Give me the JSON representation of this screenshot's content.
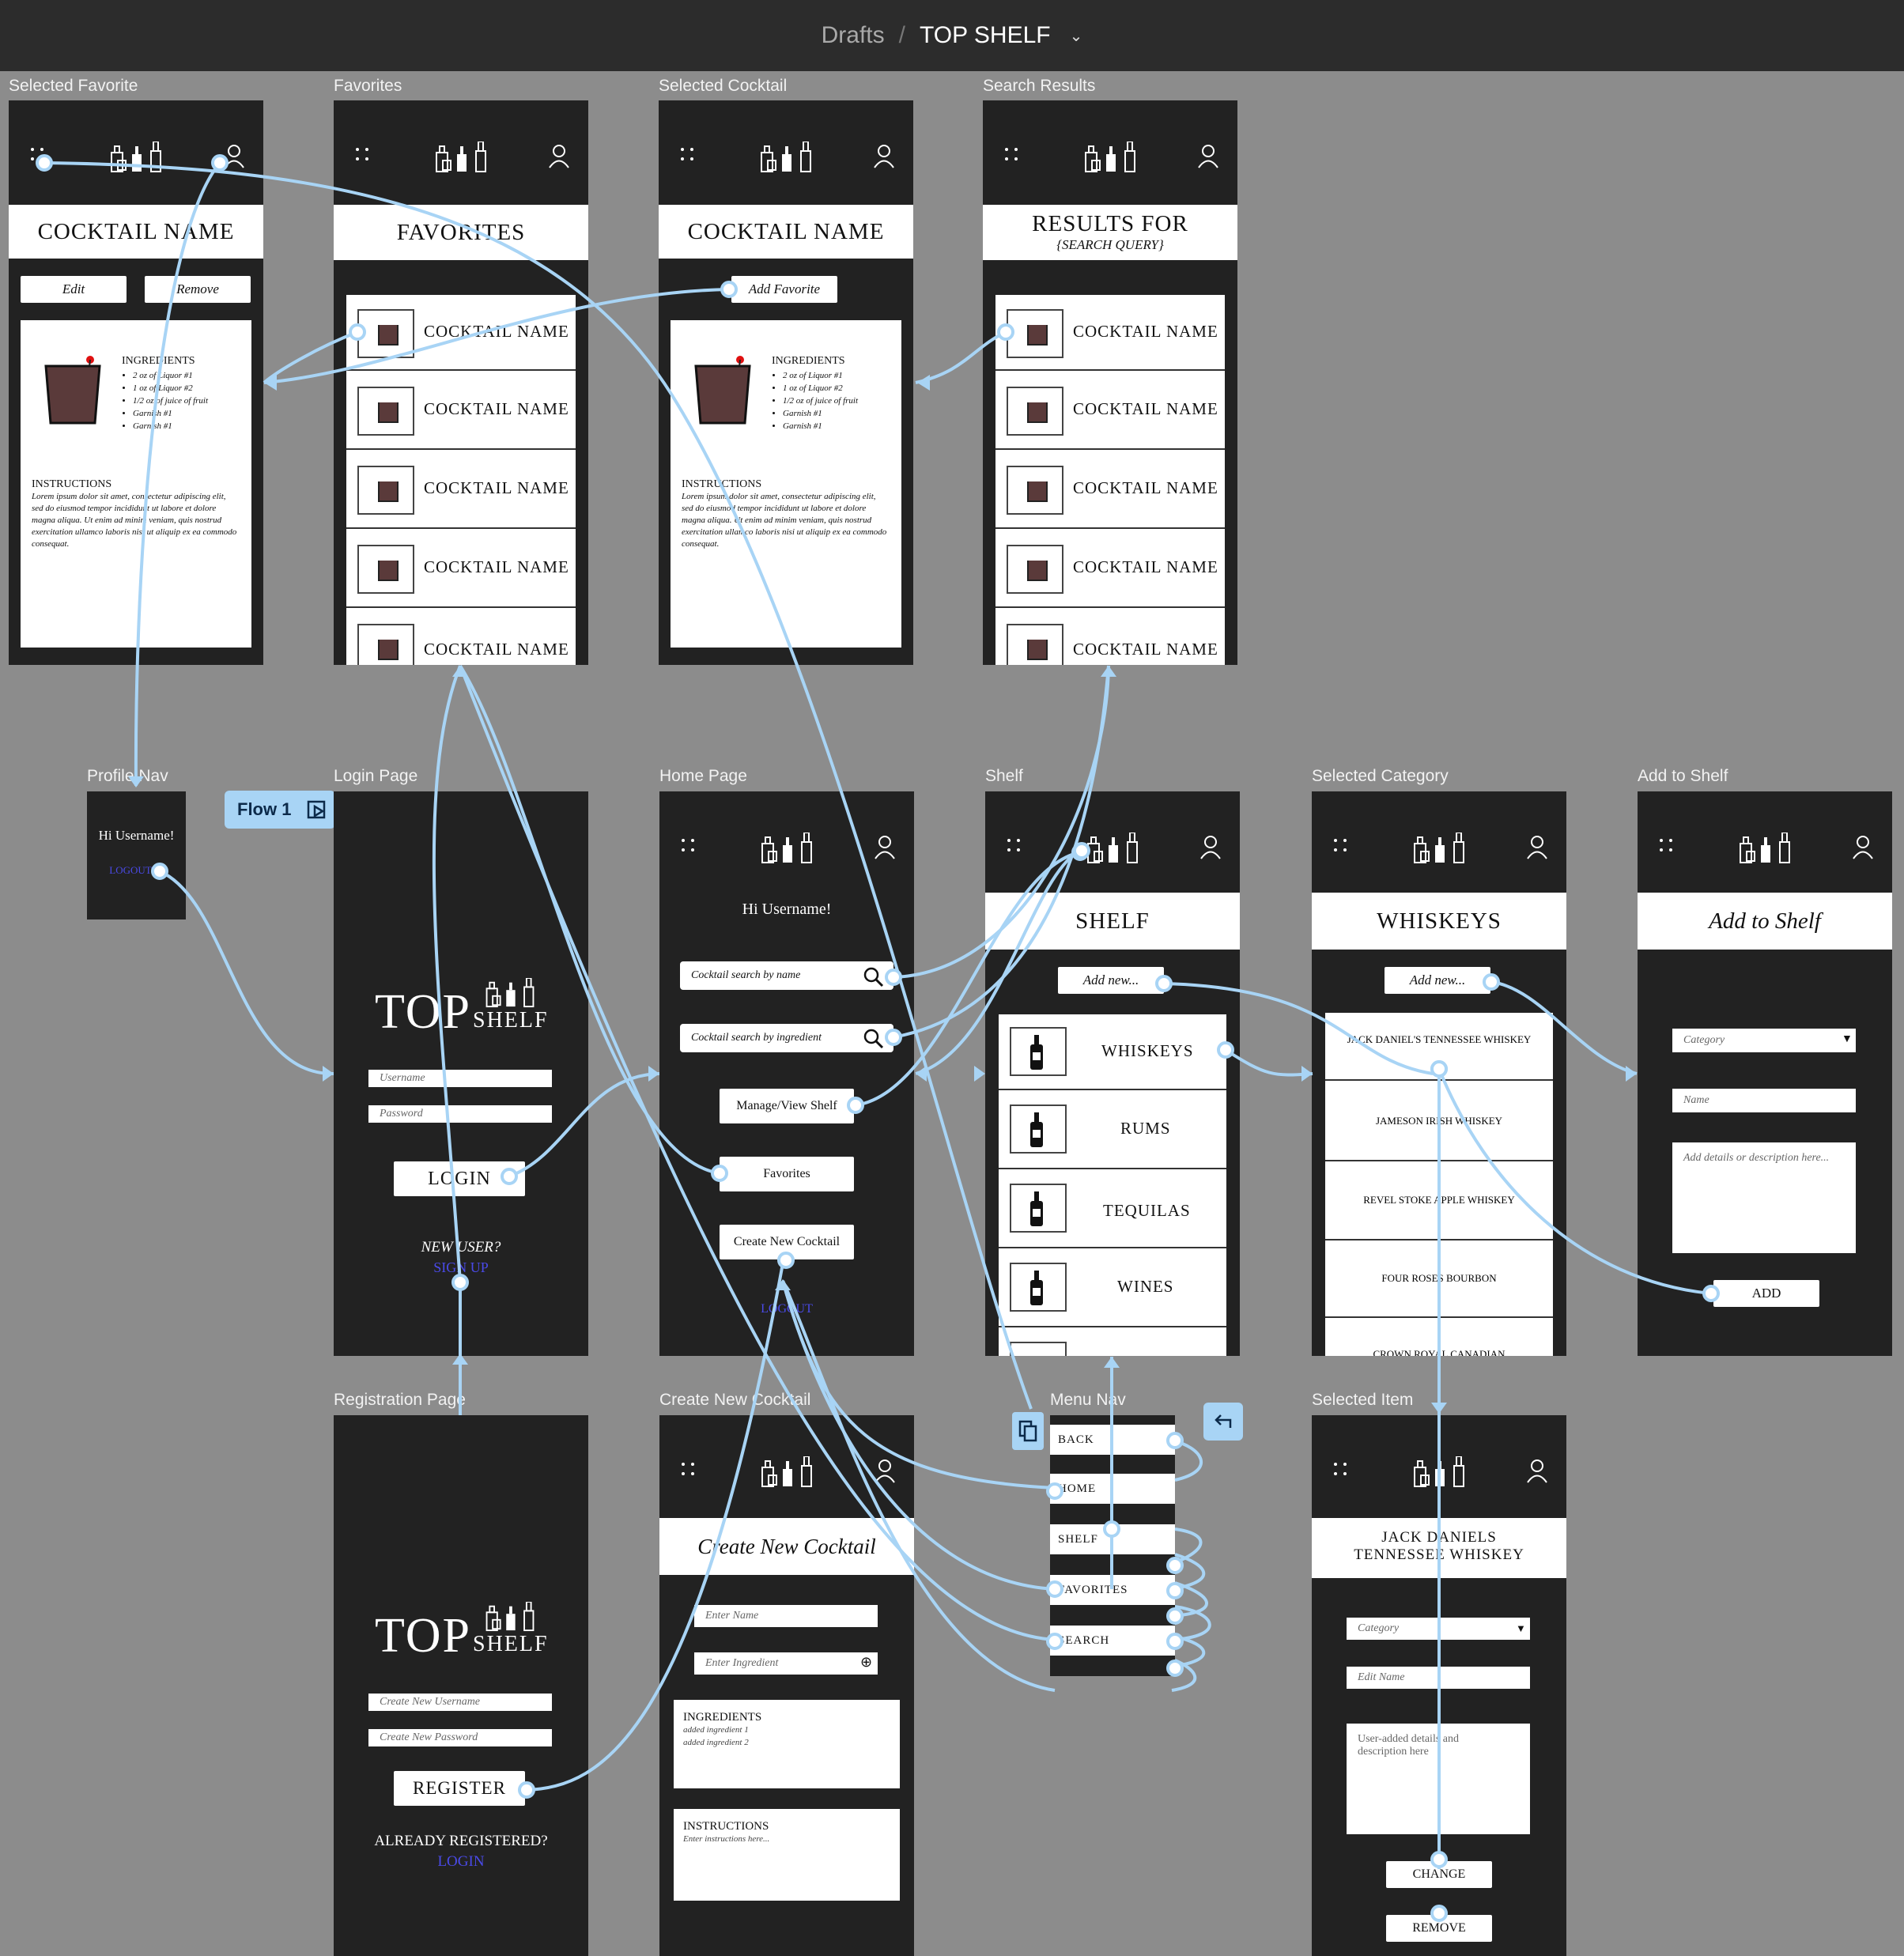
{
  "topbar": {
    "crumb": "Drafts",
    "separator": "/",
    "project": "TOP SHELF"
  },
  "flow_label": "Flow 1",
  "frames": {
    "selected_favorite": {
      "label": "Selected Favorite",
      "title": "COCKTAIL NAME",
      "edit": "Edit",
      "remove": "Remove",
      "ingredients_title": "INGREDIENTS",
      "ingredients": [
        "2 oz of Liquor #1",
        "1 oz of Liquor #2",
        "1/2 oz of juice of fruit",
        "Garnish #1",
        "Garnish #1"
      ],
      "instructions_title": "INSTRUCTIONS",
      "instructions": "Lorem ipsum dolor sit amet, consectetur adipiscing elit, sed do eiusmod tempor incididunt ut labore et dolore magna aliqua. Ut enim ad minim veniam, quis nostrud exercitation ullamco laboris nisi ut aliquip ex ea commodo consequat."
    },
    "favorites": {
      "label": "Favorites",
      "title": "FAVORITES",
      "items": [
        "COCKTAIL NAME",
        "COCKTAIL NAME",
        "COCKTAIL NAME",
        "COCKTAIL NAME",
        "COCKTAIL NAME"
      ]
    },
    "selected_cocktail": {
      "label": "Selected Cocktail",
      "title": "COCKTAIL NAME",
      "add_favorite": "Add Favorite",
      "ingredients_title": "INGREDIENTS",
      "ingredients": [
        "2 oz of Liquor #1",
        "1 oz of Liquor #2",
        "1/2 oz of juice of fruit",
        "Garnish #1",
        "Garnish #1"
      ],
      "instructions_title": "INSTRUCTIONS",
      "instructions": "Lorem ipsum dolor sit amet, consectetur adipiscing elit, sed do eiusmod tempor incididunt ut labore et dolore magna aliqua. Ut enim ad minim veniam, quis nostrud exercitation ullamco laboris nisi ut aliquip ex ea commodo consequat."
    },
    "search_results": {
      "label": "Search Results",
      "title": "RESULTS FOR",
      "subtitle": "{SEARCH QUERY}",
      "items": [
        "COCKTAIL NAME",
        "COCKTAIL NAME",
        "COCKTAIL NAME",
        "COCKTAIL NAME",
        "COCKTAIL NAME"
      ]
    },
    "profile_nav": {
      "label": "Profile Nav",
      "greeting": "Hi Username!",
      "logout": "LOGOUT"
    },
    "login": {
      "label": "Login Page",
      "brand_top": "TOP",
      "brand_shelf": "SHELF",
      "username": "Username",
      "password": "Password",
      "login_btn": "LOGIN",
      "new_user": "NEW USER?",
      "signup": "SIGN UP"
    },
    "home": {
      "label": "Home Page",
      "greeting": "Hi Username!",
      "search_name": "Cocktail search by name",
      "search_ingredient": "Cocktail search by ingredient",
      "manage": "Manage/View Shelf",
      "favorites": "Favorites",
      "create": "Create New Cocktail",
      "logout": "LOGOUT"
    },
    "shelf": {
      "label": "Shelf",
      "title": "SHELF",
      "add_new": "Add new...",
      "items": [
        "WHISKEYS",
        "RUMS",
        "TEQUILAS",
        "WINES"
      ]
    },
    "selected_category": {
      "label": "Selected Category",
      "title": "WHISKEYS",
      "add_new": "Add new...",
      "items": [
        "JACK DANIEL'S TENNESSEE WHISKEY",
        "JAMESON IRISH WHISKEY",
        "REVEL STOKE APPLE WHISKEY",
        "FOUR ROSES BOURBON",
        "CROWN ROYAL CANADIAN"
      ]
    },
    "add_to_shelf": {
      "label": "Add to Shelf",
      "title": "Add to Shelf",
      "category": "Category",
      "name": "Name",
      "details": "Add details or description here...",
      "add_btn": "ADD"
    },
    "registration": {
      "label": "Registration Page",
      "brand_top": "TOP",
      "brand_shelf": "SHELF",
      "new_username": "Create New Username",
      "new_password": "Create New Password",
      "register_btn": "REGISTER",
      "already": "ALREADY REGISTERED?",
      "login": "LOGIN"
    },
    "create_cocktail": {
      "label": "Create New Cocktail",
      "title": "Create New Cocktail",
      "enter_name": "Enter Name",
      "enter_ingredient": "Enter Ingredient",
      "ingredients_title": "INGREDIENTS",
      "added": [
        "added ingredient 1",
        "added ingredient 2"
      ],
      "instructions_title": "INSTRUCTIONS",
      "instructions_ph": "Enter instructions here..."
    },
    "menu_nav": {
      "label": "Menu Nav",
      "items": [
        "BACK",
        "HOME",
        "SHELF",
        "FAVORITES",
        "SEARCH"
      ]
    },
    "selected_item": {
      "label": "Selected Item",
      "title_line1": "JACK DANIELS",
      "title_line2": "TENNESSEE WHISKEY",
      "category": "Category",
      "edit_name": "Edit Name",
      "details": "User-added details and description here",
      "change_btn": "CHANGE",
      "remove_btn": "REMOVE"
    }
  },
  "colors": {
    "canvas": "#8c8c8c",
    "frame": "#222222",
    "connector": "#a8d4f5",
    "link": "#4a4ae8"
  }
}
